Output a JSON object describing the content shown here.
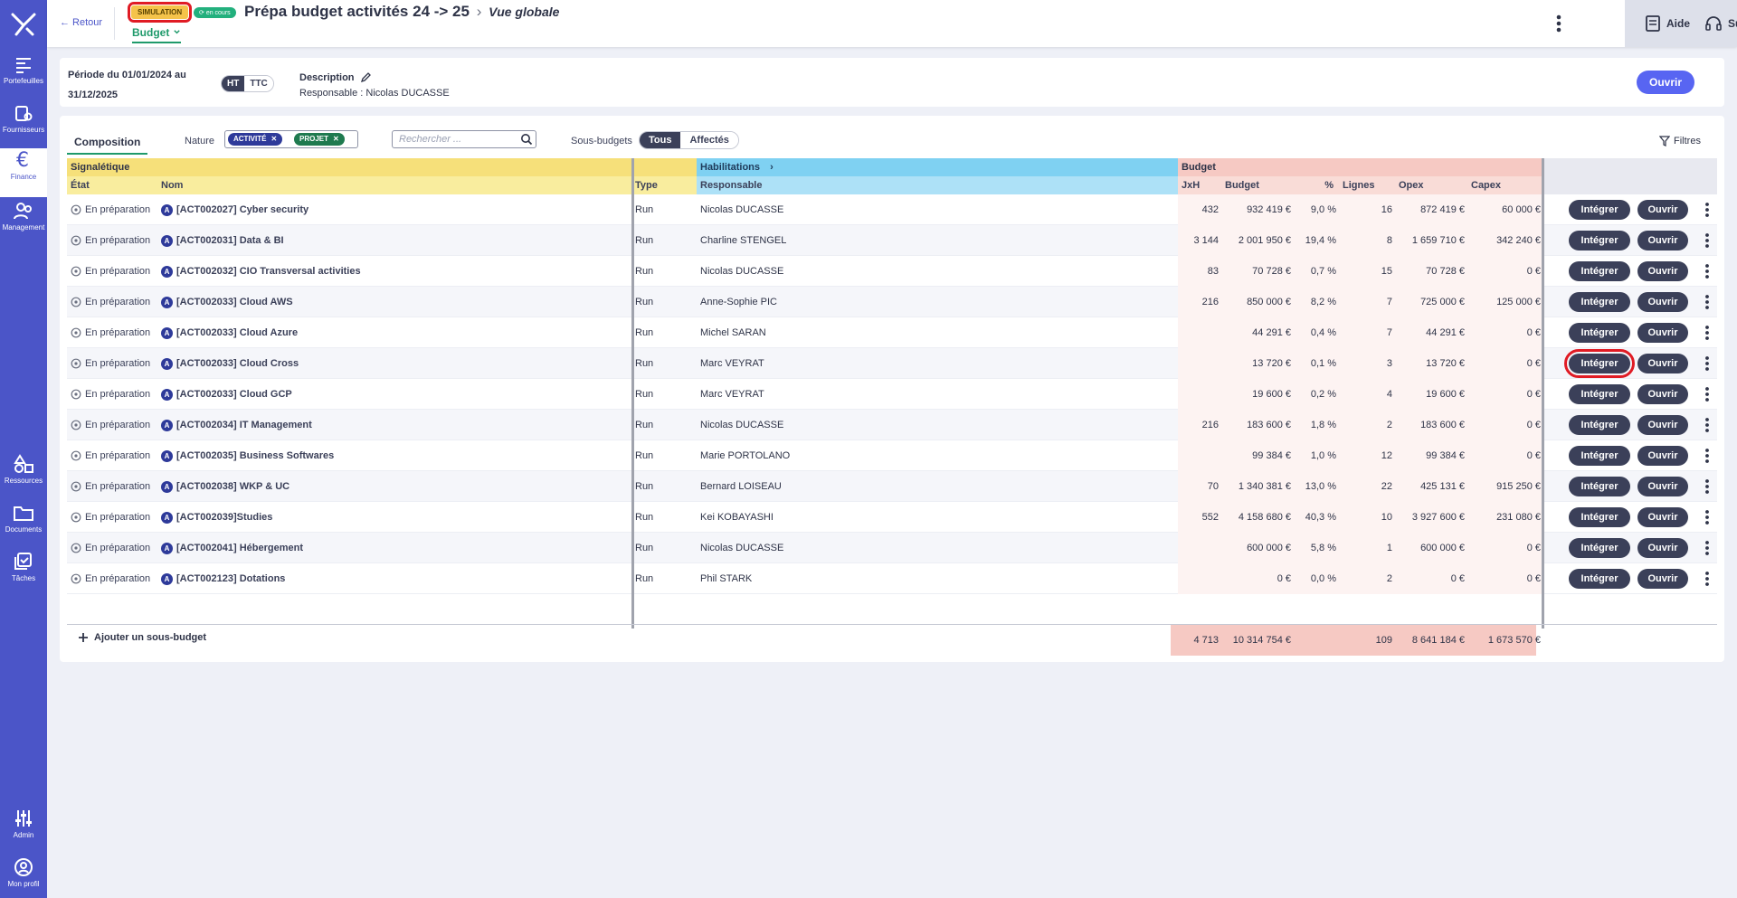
{
  "colors": {
    "sidebar": "#4b55c8",
    "accent": "#5865f2",
    "signaletique": "#f6e07a",
    "habilitations": "#7fd1f2",
    "budget": "#f6c9c3"
  },
  "sidebar": {
    "items": [
      {
        "label": "Portefeuilles",
        "icon": "portfolio-icon"
      },
      {
        "label": "Fournisseurs",
        "icon": "suppliers-icon"
      },
      {
        "label": "Finance",
        "icon": "euro-icon"
      },
      {
        "label": "Management",
        "icon": "users-icon"
      },
      {
        "label": "Ressources",
        "icon": "shapes-icon"
      },
      {
        "label": "Documents",
        "icon": "folder-icon"
      },
      {
        "label": "Tâches",
        "icon": "tasks-icon"
      },
      {
        "label": "Admin",
        "icon": "sliders-icon"
      },
      {
        "label": "Mon profil",
        "icon": "profile-icon"
      }
    ]
  },
  "header": {
    "back": "← Retour",
    "simulation": "SIMULATION",
    "status": "en cours",
    "title": "Prépa budget activités 24 -> 25",
    "chevron": "›",
    "view": "Vue globale",
    "tab": "Budget",
    "help": "Aide",
    "support": "Support"
  },
  "info": {
    "period": "Période du 01/01/2024 au 31/12/2025",
    "ht": "HT",
    "ttc": "TTC",
    "description": "Description",
    "responsable": "Responsable : Nicolas DUCASSE",
    "open": "Ouvrir"
  },
  "toolbar": {
    "tab": "Composition",
    "nature_label": "Nature",
    "chips": [
      "ACTIVITÉ",
      "PROJET"
    ],
    "search_placeholder": "Rechercher ...",
    "sb_label": "Sous-budgets",
    "seg": [
      "Tous",
      "Affectés"
    ],
    "filters": "Filtres"
  },
  "table": {
    "groups": {
      "signaletique": "Signalétique",
      "habilitations": "Habilitations",
      "habilitations_chevron": "›",
      "budget": "Budget"
    },
    "columns": {
      "etat": "État",
      "nom": "Nom",
      "type": "Type",
      "responsable": "Responsable",
      "jxh": "JxH",
      "budget": "Budget",
      "pct": "%",
      "lignes": "Lignes",
      "opex": "Opex",
      "capex": "Capex"
    },
    "actions": {
      "integrate": "Intégrer",
      "open": "Ouvrir"
    },
    "rows": [
      {
        "etat": "En préparation",
        "nom": "[ACT002027] Cyber security",
        "type": "Run",
        "responsable": "Nicolas DUCASSE",
        "jxh": "432",
        "budget": "932 419 €",
        "pct": "9,0 %",
        "lignes": "16",
        "opex": "872 419 €",
        "capex": "60 000 €"
      },
      {
        "etat": "En préparation",
        "nom": "[ACT002031] Data & BI",
        "type": "Run",
        "responsable": "Charline STENGEL",
        "jxh": "3 144",
        "budget": "2 001 950 €",
        "pct": "19,4 %",
        "lignes": "8",
        "opex": "1 659 710 €",
        "capex": "342 240 €"
      },
      {
        "etat": "En préparation",
        "nom": "[ACT002032] CIO Transversal activities",
        "type": "Run",
        "responsable": "Nicolas DUCASSE",
        "jxh": "83",
        "budget": "70 728 €",
        "pct": "0,7 %",
        "lignes": "15",
        "opex": "70 728 €",
        "capex": "0 €"
      },
      {
        "etat": "En préparation",
        "nom": "[ACT002033] Cloud AWS",
        "type": "Run",
        "responsable": "Anne-Sophie PIC",
        "jxh": "216",
        "budget": "850 000 €",
        "pct": "8,2 %",
        "lignes": "7",
        "opex": "725 000 €",
        "capex": "125 000 €"
      },
      {
        "etat": "En préparation",
        "nom": "[ACT002033] Cloud Azure",
        "type": "Run",
        "responsable": "Michel SARAN",
        "jxh": "",
        "budget": "44 291 €",
        "pct": "0,4 %",
        "lignes": "7",
        "opex": "44 291 €",
        "capex": "0 €"
      },
      {
        "etat": "En préparation",
        "nom": "[ACT002033] Cloud Cross",
        "type": "Run",
        "responsable": "Marc VEYRAT",
        "jxh": "",
        "budget": "13 720 €",
        "pct": "0,1 %",
        "lignes": "3",
        "opex": "13 720 €",
        "capex": "0 €"
      },
      {
        "etat": "En préparation",
        "nom": "[ACT002033] Cloud GCP",
        "type": "Run",
        "responsable": "Marc VEYRAT",
        "jxh": "",
        "budget": "19 600 €",
        "pct": "0,2 %",
        "lignes": "4",
        "opex": "19 600 €",
        "capex": "0 €"
      },
      {
        "etat": "En préparation",
        "nom": "[ACT002034] IT Management",
        "type": "Run",
        "responsable": "Nicolas DUCASSE",
        "jxh": "216",
        "budget": "183 600 €",
        "pct": "1,8 %",
        "lignes": "2",
        "opex": "183 600 €",
        "capex": "0 €"
      },
      {
        "etat": "En préparation",
        "nom": "[ACT002035] Business Softwares",
        "type": "Run",
        "responsable": "Marie PORTOLANO",
        "jxh": "",
        "budget": "99 384 €",
        "pct": "1,0 %",
        "lignes": "12",
        "opex": "99 384 €",
        "capex": "0 €"
      },
      {
        "etat": "En préparation",
        "nom": "[ACT002038] WKP & UC",
        "type": "Run",
        "responsable": "Bernard LOISEAU",
        "jxh": "70",
        "budget": "1 340 381 €",
        "pct": "13,0 %",
        "lignes": "22",
        "opex": "425 131 €",
        "capex": "915 250 €"
      },
      {
        "etat": "En préparation",
        "nom": "[ACT002039]Studies",
        "type": "Run",
        "responsable": "Kei KOBAYASHI",
        "jxh": "552",
        "budget": "4 158 680 €",
        "pct": "40,3 %",
        "lignes": "10",
        "opex": "3 927 600 €",
        "capex": "231 080 €"
      },
      {
        "etat": "En préparation",
        "nom": "[ACT002041] Hébergement",
        "type": "Run",
        "responsable": "Nicolas DUCASSE",
        "jxh": "",
        "budget": "600 000 €",
        "pct": "5,8 %",
        "lignes": "1",
        "opex": "600 000 €",
        "capex": "0 €"
      },
      {
        "etat": "En préparation",
        "nom": "[ACT002123] Dotations",
        "type": "Run",
        "responsable": "Phil STARK",
        "jxh": "",
        "budget": "0 €",
        "pct": "0,0 %",
        "lignes": "2",
        "opex": "0 €",
        "capex": "0 €"
      }
    ],
    "add_label": "Ajouter un sous-budget",
    "totals": {
      "jxh": "4 713",
      "budget": "10 314 754 €",
      "lignes": "109",
      "opex": "8 641 184 €",
      "capex": "1 673 570 €"
    }
  }
}
